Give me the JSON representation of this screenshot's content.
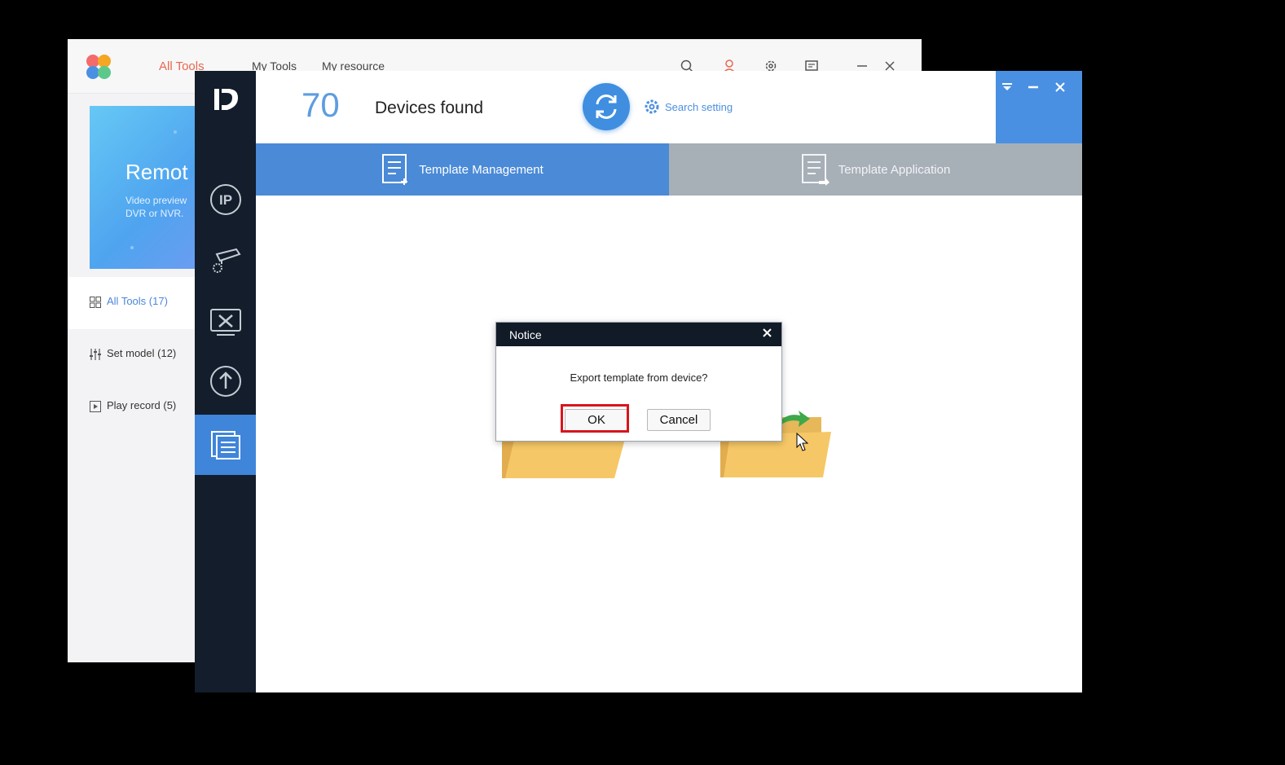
{
  "back_window": {
    "tabs": [
      {
        "label": "All Tools"
      },
      {
        "label": "My Tools"
      },
      {
        "label": "My resource"
      }
    ],
    "banner": {
      "title": "Remot",
      "subtitle_line1": "Video preview",
      "subtitle_line2": "DVR or NVR."
    },
    "nav": [
      {
        "label": "All Tools (17)",
        "icon": "grid-icon"
      },
      {
        "label": "Set model (12)",
        "icon": "sliders-icon"
      },
      {
        "label": "Play record (5)",
        "icon": "play-icon"
      }
    ],
    "top_icons": [
      "search-icon",
      "user-icon",
      "gear-icon",
      "feedback-icon",
      "minimize-icon",
      "close-icon"
    ]
  },
  "front_window": {
    "device_count": "70",
    "devices_found_label": "Devices found",
    "search_setting_label": "Search setting",
    "tabs": {
      "template_management": "Template Management",
      "template_application": "Template Application"
    },
    "colors": {
      "accent": "#4a8ad7",
      "sidebar": "#131d2b",
      "inactive_tab": "#a7afb7"
    }
  },
  "dialog": {
    "title": "Notice",
    "message": "Export template from device?",
    "ok_label": "OK",
    "cancel_label": "Cancel",
    "highlight_color": "#d7151d"
  }
}
